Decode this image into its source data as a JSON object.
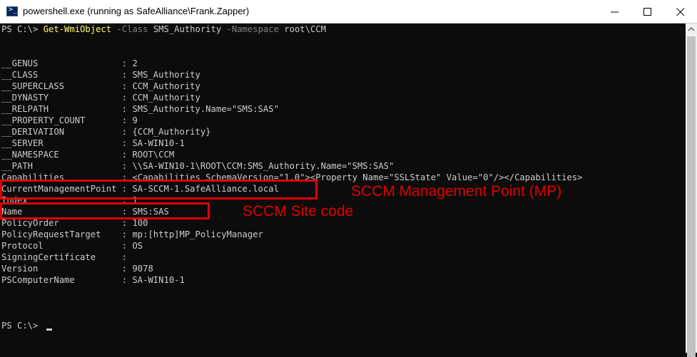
{
  "window": {
    "title": "powershell.exe (running as SafeAlliance\\Frank.Zapper)",
    "icon": "powershell-icon",
    "controls": [
      "minimize-icon",
      "maximize-icon",
      "close-icon"
    ]
  },
  "console": {
    "prompt": "PS C:\\> ",
    "command": {
      "cmdlet": "Get-WmiObject",
      "param1": "-Class",
      "value1": "SMS_Authority",
      "param2": "-Namespace",
      "value2": "root\\CCM"
    },
    "properties": [
      {
        "name": "__GENUS",
        "value": "2"
      },
      {
        "name": "__CLASS",
        "value": "SMS_Authority"
      },
      {
        "name": "__SUPERCLASS",
        "value": "CCM_Authority"
      },
      {
        "name": "__DYNASTY",
        "value": "CCM_Authority"
      },
      {
        "name": "__RELPATH",
        "value": "SMS_Authority.Name=\"SMS:SAS\""
      },
      {
        "name": "__PROPERTY_COUNT",
        "value": "9"
      },
      {
        "name": "__DERIVATION",
        "value": "{CCM_Authority}"
      },
      {
        "name": "__SERVER",
        "value": "SA-WIN10-1"
      },
      {
        "name": "__NAMESPACE",
        "value": "ROOT\\CCM"
      },
      {
        "name": "__PATH",
        "value": "\\\\SA-WIN10-1\\ROOT\\CCM:SMS_Authority.Name=\"SMS:SAS\""
      },
      {
        "name": "Capabilities",
        "value": "<Capabilities SchemaVersion=\"1.0\"><Property Name=\"SSLState\" Value=\"0\"/></Capabilities>"
      },
      {
        "name": "CurrentManagementPoint",
        "value": "SA-SCCM-1.SafeAlliance.local"
      },
      {
        "name": "Index",
        "value": "1"
      },
      {
        "name": "Name",
        "value": "SMS:SAS"
      },
      {
        "name": "PolicyOrder",
        "value": "100"
      },
      {
        "name": "PolicyRequestTarget",
        "value": "mp:[http]MP_PolicyManager"
      },
      {
        "name": "Protocol",
        "value": "OS"
      },
      {
        "name": "SigningCertificate",
        "value": ""
      },
      {
        "name": "Version",
        "value": "9078"
      },
      {
        "name": "PSComputerName",
        "value": "SA-WIN10-1"
      }
    ],
    "final_prompt": "PS C:\\> "
  },
  "annotations": {
    "mp_label": "SCCM Management Point (MP)",
    "site_code_label": "SCCM Site code",
    "highlight_color": "#e10000"
  },
  "colors": {
    "background": "#0c0c0c",
    "text": "#cccccc",
    "cmdlet": "#ffff66",
    "parameter": "#808080"
  }
}
